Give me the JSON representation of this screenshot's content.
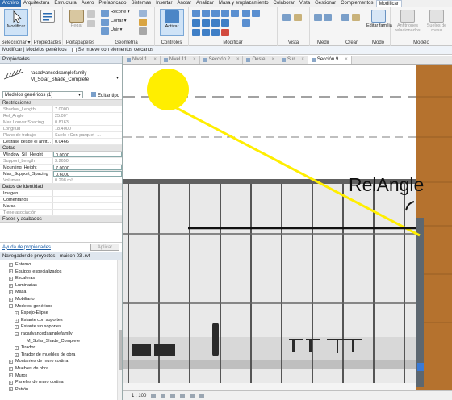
{
  "menu": {
    "tabs": [
      "Archivo",
      "Arquitectura",
      "Estructura",
      "Acero",
      "Prefabricado",
      "Sistemas",
      "Insertar",
      "Anotar",
      "Analizar",
      "Masa y emplazamiento",
      "Colaborar",
      "Vista",
      "Gestionar",
      "Complementos",
      "Modificar"
    ],
    "active": "Archivo"
  },
  "ribbon": {
    "modify_label": "Modificar",
    "selection_label": "Seleccionar ▾",
    "properties_group": "Propiedades",
    "clipboard_group": "Portapapeles",
    "paste_label": "Pegar",
    "geometry_group": "Geometría",
    "cut_small": [
      "Recorte ▾",
      "Cortar ▾",
      "Unir ▾"
    ],
    "controls_group": "Controles",
    "activate_label": "Activar",
    "modify_group": "Modificar",
    "view_group": "Vista",
    "measure_group": "Medir",
    "create_group": "Crear",
    "edit_family": "Editar familia",
    "edit_family_2": "familia",
    "mode_group": "Modo",
    "adaptive_label": "Anfitriones relacionados",
    "site_label": "Suelos de masa",
    "model_group": "Modelo"
  },
  "options_bar": {
    "context": "Modificar | Modelos genéricos",
    "checkbox_label": "Se mueve con elementos cercanos"
  },
  "properties": {
    "title": "Propiedades",
    "family_name": "racadvancedsamplefamily",
    "type_name": "M_Solar_Shade_Complete",
    "filter": "Modelos genéricos (1)",
    "edit_type": "Editar tipo",
    "categories": [
      {
        "name": "Restricciones",
        "rows": [
          {
            "k": "Shadow_Length",
            "v": "7.0000",
            "dim": true
          },
          {
            "k": "Rel_Angle",
            "v": "25.00°",
            "dim": true
          },
          {
            "k": "Max Louver Spacing",
            "v": "0.8163",
            "dim": true
          },
          {
            "k": "Longitud",
            "v": "18.4000",
            "dim": true
          },
          {
            "k": "Plano de trabajo",
            "v": "Suelo : Con parquet -...",
            "dim": true
          },
          {
            "k": "Desfase desde el anfit...",
            "v": "0.0466",
            "dim": false
          }
        ]
      },
      {
        "name": "Cotas",
        "rows": [
          {
            "k": "Window_Sill_Height",
            "v": "0.0000",
            "dim": false,
            "edit": true
          },
          {
            "k": "Support_Length",
            "v": "3.2650",
            "dim": true
          },
          {
            "k": "Mounting_Height",
            "v": "7.0000",
            "dim": false,
            "edit": true
          },
          {
            "k": "Max_Support_Spacing",
            "v": "0.6000",
            "dim": false,
            "edit": true
          },
          {
            "k": "Volumen",
            "v": "0.298 m³",
            "dim": true
          }
        ]
      },
      {
        "name": "Datos de identidad",
        "rows": [
          {
            "k": "Imagen",
            "v": "",
            "dim": false
          },
          {
            "k": "Comentarios",
            "v": "",
            "dim": false
          },
          {
            "k": "Marca",
            "v": "",
            "dim": false
          },
          {
            "k": "Tiene asociación",
            "v": "",
            "dim": true
          }
        ]
      },
      {
        "name": "Fases y acabados",
        "rows": []
      }
    ],
    "help_link": "Ayuda de propiedades",
    "apply": "Aplicar"
  },
  "browser": {
    "title": "Navegador de proyectos - maison 03 .rvt",
    "items": [
      {
        "label": "Entorno",
        "level": 1,
        "toggle": "+"
      },
      {
        "label": "Equipos especializados",
        "level": 1,
        "toggle": "+"
      },
      {
        "label": "Escaleras",
        "level": 1,
        "toggle": "+"
      },
      {
        "label": "Luminarias",
        "level": 1,
        "toggle": "+"
      },
      {
        "label": "Masa",
        "level": 1,
        "toggle": "+"
      },
      {
        "label": "Mobiliario",
        "level": 1,
        "toggle": "+"
      },
      {
        "label": "Modelos genéricos",
        "level": 1,
        "toggle": "−"
      },
      {
        "label": "Espejo-Elipse",
        "level": 2,
        "toggle": "+"
      },
      {
        "label": "Estante con soportes",
        "level": 2,
        "toggle": "+"
      },
      {
        "label": "Estante sin soportes",
        "level": 2,
        "toggle": "+"
      },
      {
        "label": "racadvancedsamplefamily",
        "level": 2,
        "toggle": "−"
      },
      {
        "label": "M_Solar_Shade_Complete",
        "level": 3,
        "toggle": ""
      },
      {
        "label": "Tirador",
        "level": 2,
        "toggle": "+"
      },
      {
        "label": "Tirador de muebles de obra",
        "level": 2,
        "toggle": "+"
      },
      {
        "label": "Montantes de muro cortina",
        "level": 1,
        "toggle": "+"
      },
      {
        "label": "Muebles de obra",
        "level": 1,
        "toggle": "+"
      },
      {
        "label": "Muros",
        "level": 1,
        "toggle": "+"
      },
      {
        "label": "Paneles de muro cortina",
        "level": 1,
        "toggle": "+"
      },
      {
        "label": "Patrón",
        "level": 1,
        "toggle": "+"
      }
    ]
  },
  "view_tabs": [
    {
      "label": "Nivel 1",
      "active": false
    },
    {
      "label": "Nivel 11",
      "active": false
    },
    {
      "label": "Sección 2",
      "active": false
    },
    {
      "label": "Oeste",
      "active": false
    },
    {
      "label": "Sur",
      "active": false
    },
    {
      "label": "Sección 9",
      "active": true
    }
  ],
  "canvas": {
    "annotation": "RelAngle",
    "sun_color": "#ffee00",
    "sun_ray_color": "#ffee00",
    "brick_color": "#b5722e",
    "sky_color": "#e9e9e9"
  },
  "view_status": {
    "scale": "1 : 100"
  }
}
